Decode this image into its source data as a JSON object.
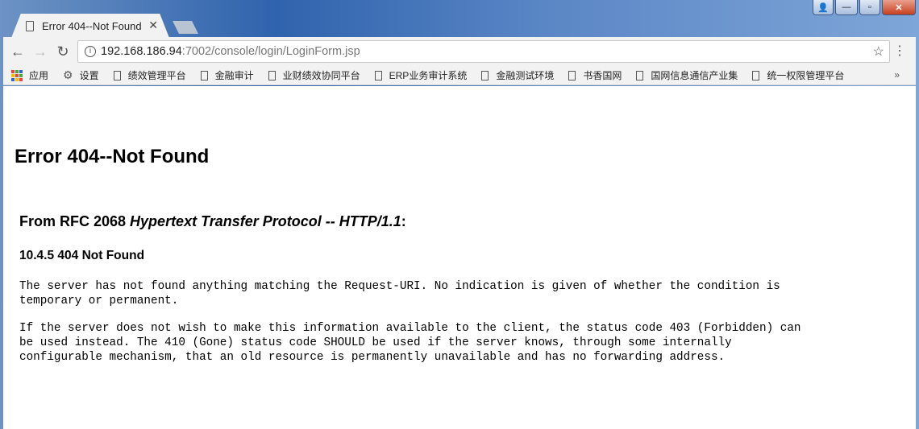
{
  "browser": {
    "tab_title": "Error 404--Not Found",
    "url_host": "192.168.186.94",
    "url_path": ":7002/console/login/LoginForm.jsp",
    "bookmarks": [
      "应用",
      "设置",
      "绩效管理平台",
      "金融审计",
      "业财绩效协同平台",
      "ERP业务审计系统",
      "金融测试环境",
      "书香国网",
      "国网信息通信产业集",
      "统一权限管理平台"
    ],
    "overflow": "»"
  },
  "content": {
    "title": "Error 404--Not Found",
    "rfc_prefix": "From RFC 2068 ",
    "rfc_italic": "Hypertext Transfer Protocol -- HTTP/1.1",
    "rfc_suffix": ":",
    "section": "10.4.5 404 Not Found",
    "para1": "The server has not found anything matching the Request-URI. No indication is given of whether the condition is\ntemporary or permanent.",
    "para2": "If the server does not wish to make this information available to the client, the status code 403 (Forbidden) can\nbe used instead. The 410 (Gone) status code SHOULD be used if the server knows, through some internally\nconfigurable mechanism, that an old resource is permanently unavailable and has no forwarding address."
  }
}
